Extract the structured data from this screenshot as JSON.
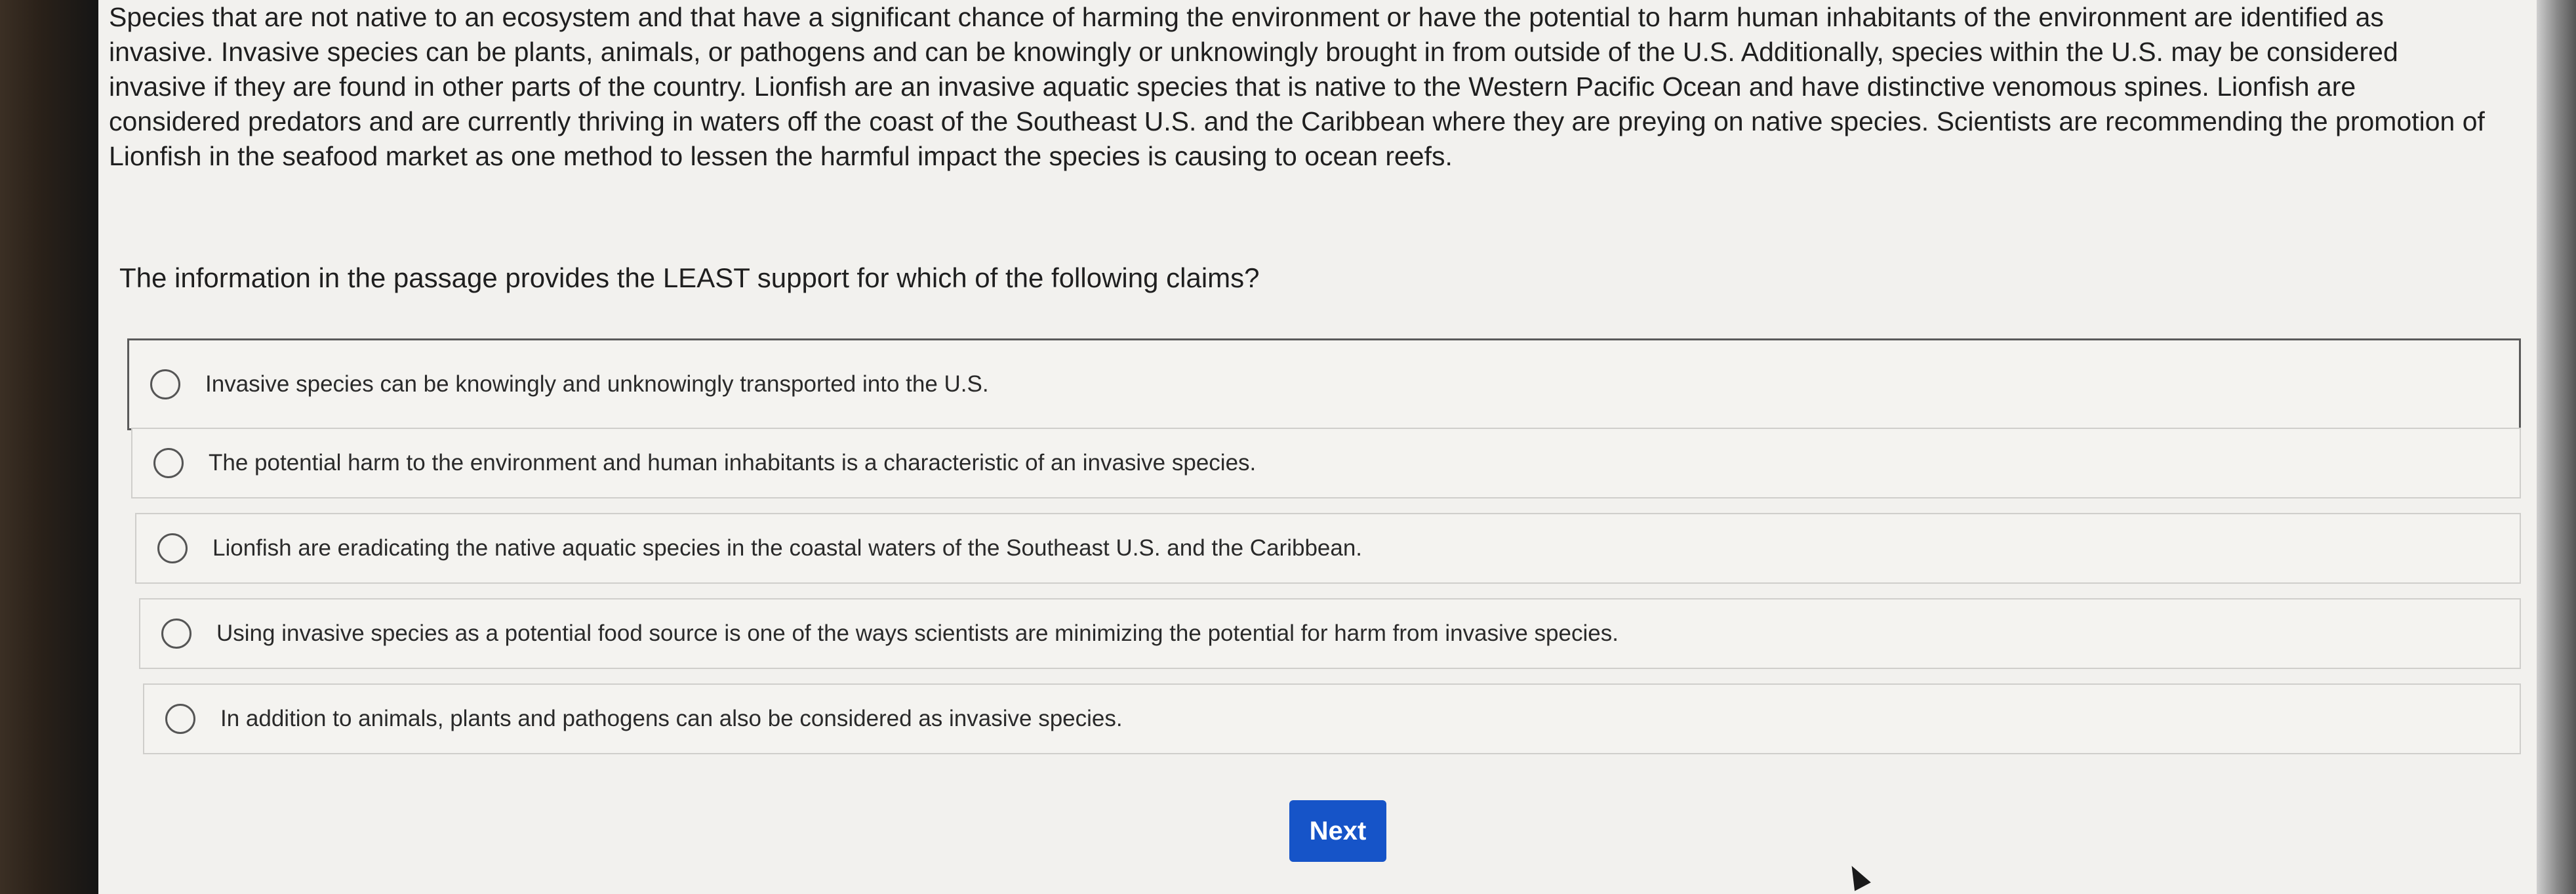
{
  "passage": {
    "lines": [
      "Species that are not native to an ecosystem and that have a significant chance of harming the environment or have the potential to harm human inhabitants of the environment are identified as",
      "invasive. Invasive species can be plants, animals, or pathogens and can be knowingly or unknowingly brought in from outside of the U.S. Additionally, species within the U.S. may be considered",
      "invasive if they are found in other parts of the country. Lionfish are an invasive aquatic species that is native to the Western Pacific Ocean and have distinctive venomous spines. Lionfish are",
      "considered predators and are currently thriving in waters off the coast of the Southeast U.S. and the Caribbean where they are preying on native species. Scientists are recommending the promotion of",
      "Lionfish in the seafood market as one method to lessen the harmful impact the species is causing to ocean reefs."
    ]
  },
  "question": {
    "text": "The information in the passage provides the LEAST support for which of the following claims?"
  },
  "choices": [
    {
      "label": "Invasive species can be knowingly and unknowingly transported into the U.S."
    },
    {
      "label": "The potential harm to the environment and human inhabitants is a characteristic of an invasive species."
    },
    {
      "label": "Lionfish are eradicating the native aquatic species in the coastal waters of the Southeast U.S. and the Caribbean."
    },
    {
      "label": "Using invasive species as a potential food source is one of the ways scientists are minimizing the potential for harm from invasive species."
    },
    {
      "label": "In addition to animals, plants and pathogens can also be considered as invasive species."
    }
  ],
  "actions": {
    "next_label": "Next"
  },
  "colors": {
    "accent": "#1654c8",
    "background": "#f2f1ee"
  }
}
